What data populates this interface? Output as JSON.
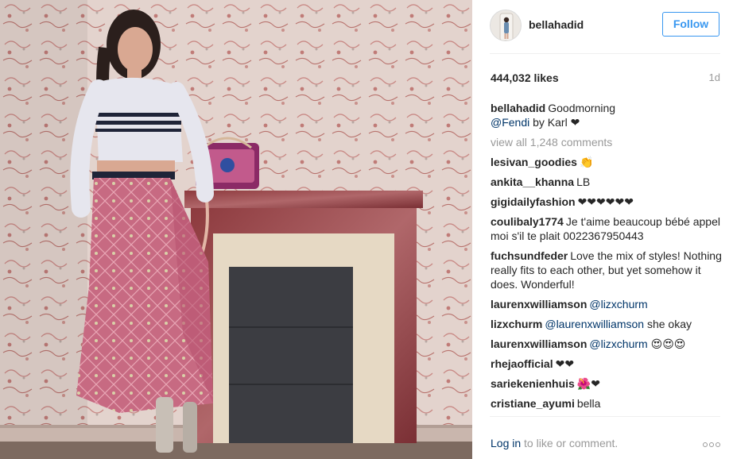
{
  "post": {
    "username": "bellahadid",
    "follow_label": "Follow",
    "likes": "444,032 likes",
    "time": "1d",
    "caption_user": "bellahadid",
    "caption_line1": "Goodmorning",
    "caption_mention": "@Fendi",
    "caption_line2": "by Karl ❤",
    "view_all": "view all 1,248 comments"
  },
  "comments": [
    {
      "user": "lesivan_goodies",
      "mention": "",
      "text": "👏"
    },
    {
      "user": "ankita__khanna",
      "mention": "",
      "text": "LB"
    },
    {
      "user": "gigidailyfashion",
      "mention": "",
      "text": "❤❤❤❤❤❤"
    },
    {
      "user": "coulibaly1774",
      "mention": "",
      "text": "Je t'aime beaucoup bébé appel moi s'il te plait 0022367950443"
    },
    {
      "user": "fuchsundfeder",
      "mention": "",
      "text": "Love the mix of styles! Nothing really fits to each other, but yet somehow it does. Wonderful!"
    },
    {
      "user": "laurenxwilliamson",
      "mention": "@lizxchurm",
      "text": ""
    },
    {
      "user": "lizxchurm",
      "mention": "@laurenxwilliamson",
      "text": "she okay"
    },
    {
      "user": "laurenxwilliamson",
      "mention": "@lizxchurm",
      "text": "😍😍😍"
    },
    {
      "user": "rhejaofficial",
      "mention": "",
      "text": "❤❤"
    },
    {
      "user": "sariekenienhuis",
      "mention": "",
      "text": "🌺❤"
    },
    {
      "user": "cristiane_ayumi",
      "mention": "",
      "text": "bella"
    }
  ],
  "footer": {
    "login_link": "Log in",
    "login_rest": "to like or comment."
  },
  "icons": {
    "more": "more-options-icon"
  },
  "colors": {
    "follow_blue": "#3897f0",
    "mention_navy": "#003569",
    "muted_gray": "#999999"
  }
}
